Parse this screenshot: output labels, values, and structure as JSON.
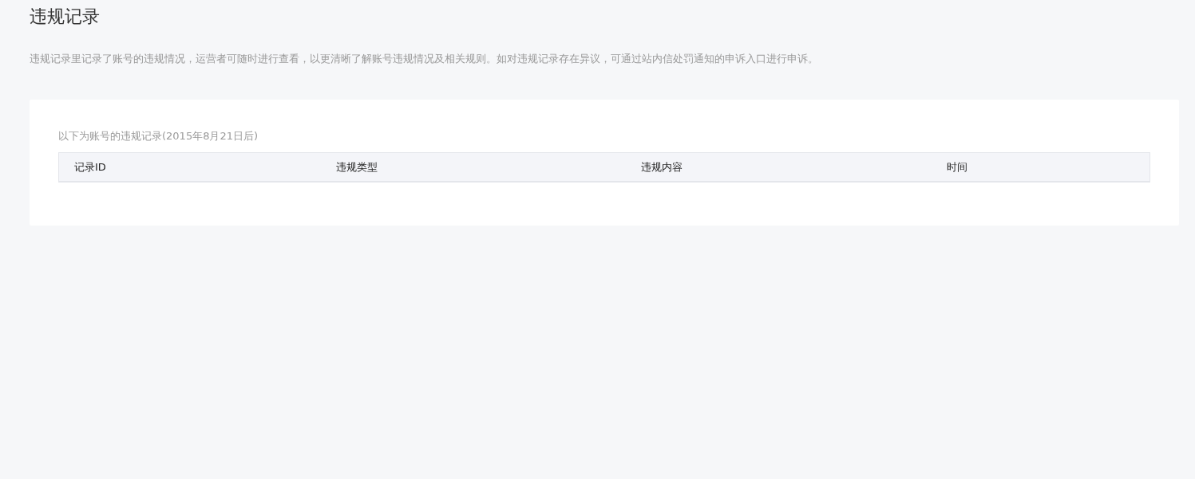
{
  "page": {
    "title": "违规记录",
    "description": "违规记录里记录了账号的违规情况，运营者可随时进行查看，以更清晰了解账号违规情况及相关规则。如对违规记录存在异议，可通过站内信处罚通知的申诉入口进行申诉。"
  },
  "records": {
    "caption": "以下为账号的违规记录(2015年8月21日后)",
    "table": {
      "columns": [
        "记录ID",
        "违规类型",
        "违规内容",
        "时间"
      ]
    }
  }
}
